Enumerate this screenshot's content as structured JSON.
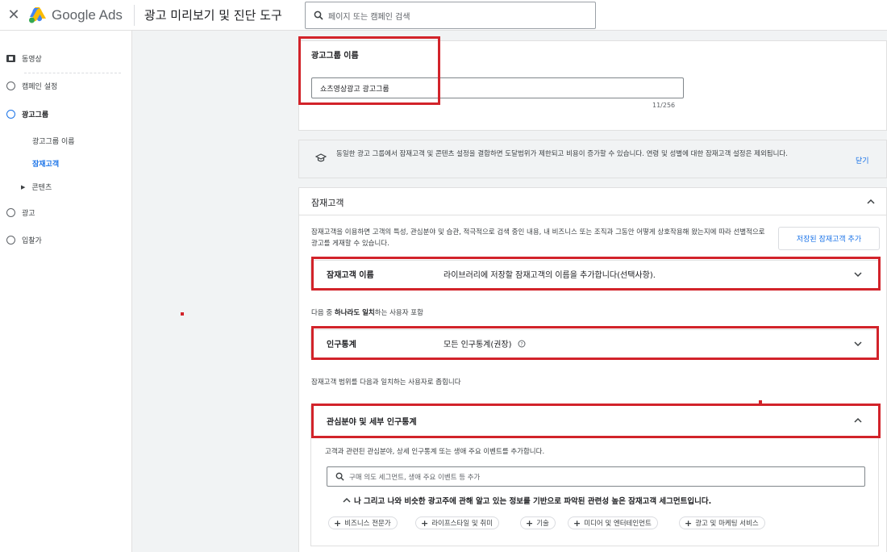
{
  "header": {
    "app_name": "Google Ads",
    "tool_title": "광고 미리보기 및 진단 도구",
    "search_placeholder": "페이지 또는 캠페인 검색"
  },
  "sidebar": {
    "items": [
      {
        "label": "동영상"
      },
      {
        "label": "캠페인 설정"
      },
      {
        "label": "광고그룹"
      },
      {
        "label": "광고그룹 이름"
      },
      {
        "label": "잠재고객"
      },
      {
        "label": "콘텐츠"
      },
      {
        "label": "광고"
      },
      {
        "label": "입찰가"
      }
    ]
  },
  "ad_group": {
    "title": "광고그룹 이름",
    "value": "쇼츠영상광고 광고그룹",
    "counter": "11/256"
  },
  "info_banner": {
    "text": "동일한 광고 그룹에서 잠재고객 및 콘텐츠 설정을 결합하면 도달범위가 제한되고 비용이 증가할 수 있습니다. 연령 및 성별에 대한 잠재고객 설정은 제외됩니다.",
    "close_label": "닫기"
  },
  "audience": {
    "title": "잠재고객",
    "description": "잠재고객을 이용하면 고객의 특성, 관심분야 및 습관, 적극적으로 검색 중인 내용, 내 비즈니스 또는 조직과 그동안 어떻게 상호작용해 왔는지에 따라 선별적으로 광고를 게재할 수 있습니다.",
    "saved_button": "저장된 잠재고객 추가",
    "name_row": {
      "label": "잠재고객 이름",
      "value": "라이브러리에 저장할 잠재고객의 이름을 추가합니다(선택사항)."
    },
    "match_text_pre": "다음 중 ",
    "match_text_bold": "하나라도 일치",
    "match_text_post": "하는 사용자 포함",
    "demographics_row": {
      "label": "인구통계",
      "value": "모든 인구통계(권장)"
    },
    "narrow_text": "잠재고객 범위를 다음과 일치하는 사용자로 좁힙니다",
    "interests": {
      "title": "관심분야 및 세부 인구통계",
      "description": "고객과 관련된 관심분야, 상세 인구통계 또는 생애 주요 이벤트를 추가합니다.",
      "search_placeholder": "구매 의도 세그먼트, 생애 주요 이벤트 등 추가",
      "suggestion_title": "나 그리고 나와 비슷한 광고주에 관해 알고 있는 정보를 기반으로 파악된 관련성 높은 잠재고객 세그먼트입니다.",
      "chips": [
        "비즈니스 전문가",
        "라이프스타일 및 취미",
        "기술",
        "미디어 및 엔터테인먼트",
        "광고 및 마케팅 서비스"
      ]
    }
  },
  "colors": {
    "accent": "#1a73e8",
    "highlight": "#d2232a"
  }
}
